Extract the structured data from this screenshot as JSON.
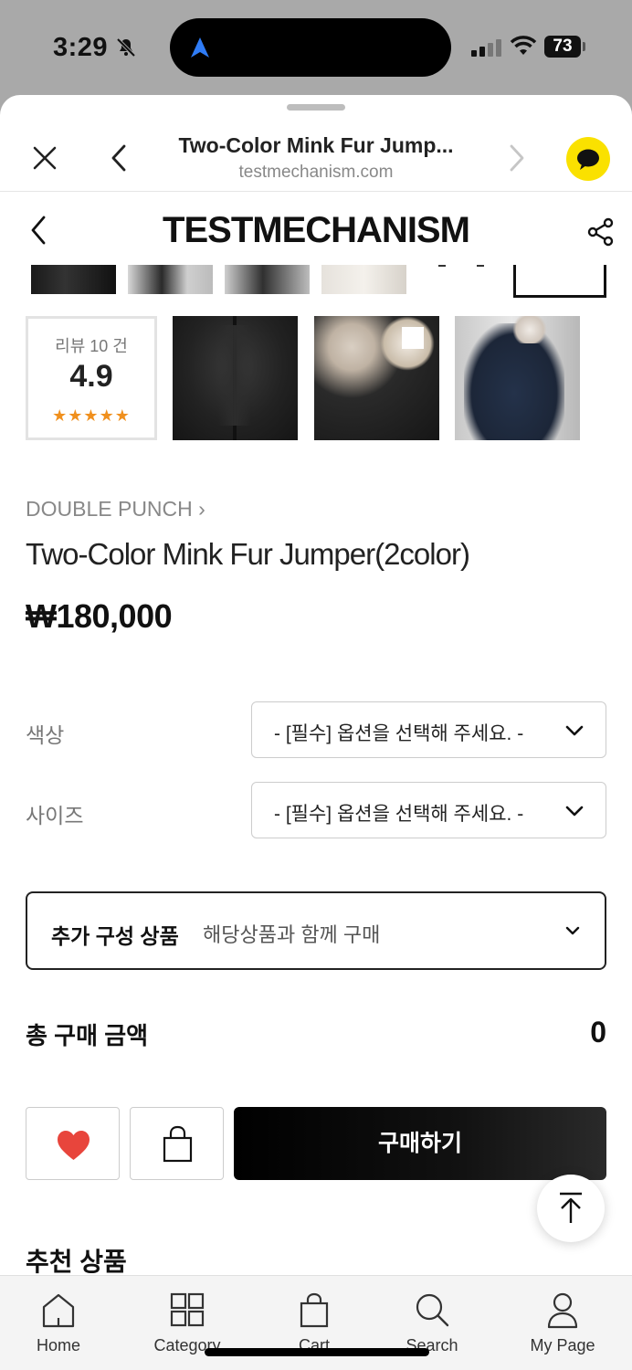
{
  "status_bar": {
    "time": "3:29",
    "battery": "73"
  },
  "browser": {
    "title": "Two-Color Mink Fur Jump...",
    "url": "testmechanism.com"
  },
  "shop": {
    "logo": "TESTMECHANISM"
  },
  "review": {
    "label": "리뷰 10 건",
    "score": "4.9",
    "stars": "★★★★★"
  },
  "product": {
    "brand": "DOUBLE PUNCH ›",
    "name": "Two-Color Mink Fur Jumper(2color)",
    "price": "₩180,000"
  },
  "options": [
    {
      "label": "색상",
      "placeholder": "- [필수] 옵션을 선택해 주세요. -"
    },
    {
      "label": "사이즈",
      "placeholder": "- [필수] 옵션을 선택해 주세요. -"
    }
  ],
  "addon": {
    "title": "추가 구성 상품",
    "subtitle": "해당상품과 함께 구매"
  },
  "total": {
    "label": "총 구매 금액",
    "value": "0"
  },
  "actions": {
    "buy_label": "구매하기"
  },
  "recommend": {
    "title": "추천 상품"
  },
  "tabbar": {
    "items": [
      {
        "label": "Home",
        "icon": "home-icon"
      },
      {
        "label": "Category",
        "icon": "grid-icon"
      },
      {
        "label": "Cart",
        "icon": "bag-icon"
      },
      {
        "label": "Search",
        "icon": "search-icon"
      },
      {
        "label": "My Page",
        "icon": "person-icon"
      }
    ]
  },
  "colors": {
    "accent_heart": "#e8453c",
    "kakao": "#fae100",
    "star": "#f0901e"
  }
}
